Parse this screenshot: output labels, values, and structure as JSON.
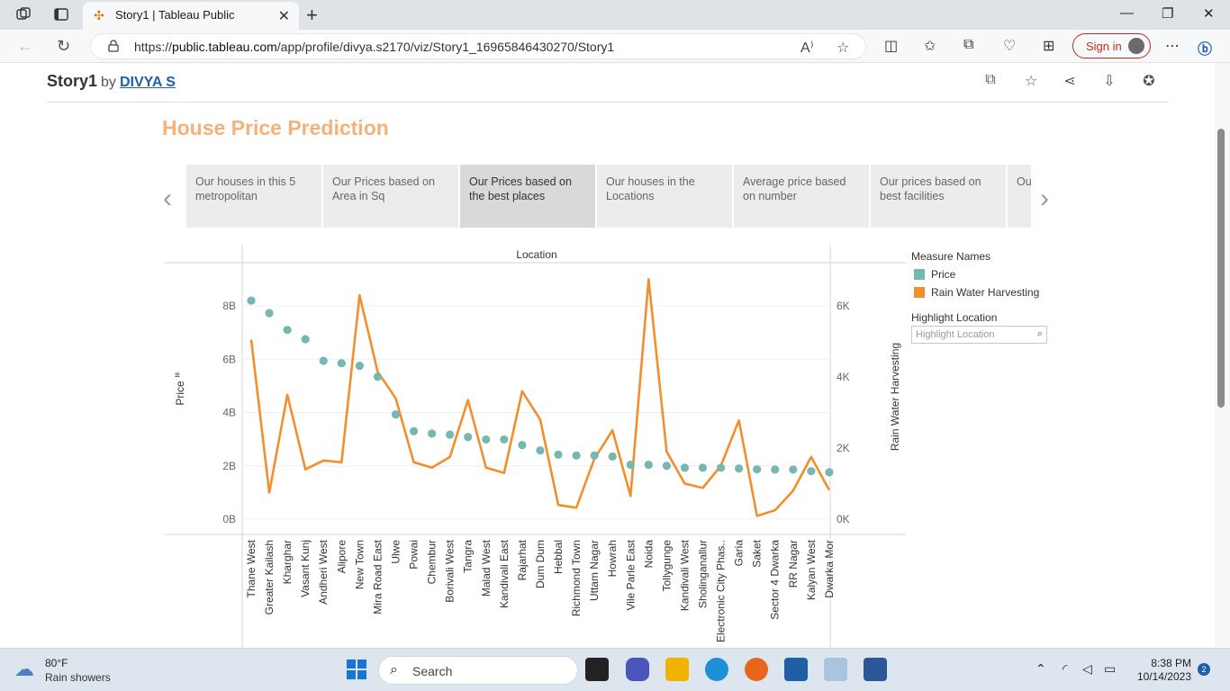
{
  "browser": {
    "tab_title": "Story1 | Tableau Public",
    "url_prefix": "https://",
    "url_host": "public.tableau.com",
    "url_path": "/app/profile/divya.s2170/viz/Story1_16965846430270/Story1",
    "sign_in": "Sign in"
  },
  "story": {
    "name": "Story1",
    "by": "by",
    "author": "DIVYA S",
    "title": "House Price Prediction",
    "points": [
      {
        "label": "Our houses in this 5 metropolitan",
        "active": false
      },
      {
        "label": "Our Prices based on Area in Sq",
        "active": false
      },
      {
        "label": "Our Prices based on the best places",
        "active": true
      },
      {
        "label": "Our houses in the Locations",
        "active": false
      },
      {
        "label": "Average price based on number",
        "active": false
      },
      {
        "label": "Our prices based on best facilities",
        "active": false
      },
      {
        "label": "Ou... bes...",
        "active": false
      }
    ]
  },
  "legend": {
    "title": "Measure Names",
    "items": [
      {
        "label": "Price",
        "color": "#76b7b2"
      },
      {
        "label": "Rain Water Harvesting",
        "color": "#f28e2b"
      }
    ],
    "highlight_title": "Highlight Location",
    "highlight_placeholder": "Highlight Location"
  },
  "chart_data": {
    "type": "line",
    "title": "Location",
    "ylabel": "Price",
    "y2label": "Rain Water Harvesting",
    "ylim": [
      0,
      8900000000
    ],
    "y2lim": [
      0,
      7000
    ],
    "yticks": [
      "0B",
      "2B",
      "4B",
      "6B",
      "8B"
    ],
    "y2ticks": [
      "0K",
      "2K",
      "4K",
      "6K"
    ],
    "categories": [
      "Thane West",
      "Greater Kailash",
      "Kharghar",
      "Vasant Kunj",
      "Andheri West",
      "Alipore",
      "New Town",
      "Mira Road East",
      "Ulwe",
      "Powai",
      "Chembur",
      "Borivali West",
      "Tangra",
      "Malad West",
      "Kandivali East",
      "Rajarhat",
      "Dum Dum",
      "Hebbal",
      "Richmond Town",
      "Uttam Nagar",
      "Howrah",
      "Vile Parle East",
      "Noida",
      "Tollygunge",
      "Kandivali West",
      "Sholinganallur",
      "Electronic City Phas..",
      "Garia",
      "Saket",
      "Sector 4 Dwarka",
      "RR Nagar",
      "Kalyan West",
      "Dwarka Mor"
    ],
    "series": [
      {
        "name": "Price",
        "type": "scatter",
        "color": "#76b7b2",
        "values": [
          8200000000,
          7730000000,
          7100000000,
          6750000000,
          5940000000,
          5850000000,
          5750000000,
          5340000000,
          3930000000,
          3300000000,
          3210000000,
          3170000000,
          3080000000,
          2990000000,
          2990000000,
          2780000000,
          2580000000,
          2420000000,
          2390000000,
          2390000000,
          2350000000,
          2040000000,
          2040000000,
          2000000000,
          1930000000,
          1930000000,
          1930000000,
          1900000000,
          1870000000,
          1860000000,
          1860000000,
          1800000000,
          1760000000
        ]
      },
      {
        "name": "Rain Water Harvesting",
        "type": "line",
        "color": "#f28e2b",
        "values": [
          5050,
          750,
          3500,
          1400,
          1650,
          1600,
          6300,
          4150,
          3400,
          1600,
          1450,
          1750,
          3350,
          1450,
          1300,
          3600,
          2800,
          400,
          320,
          1700,
          2500,
          650,
          6750,
          1900,
          1000,
          880,
          1500,
          2780,
          90,
          250,
          800,
          1750,
          820
        ]
      }
    ]
  },
  "taskbar": {
    "temp": "80°F",
    "condition": "Rain showers",
    "search": "Search",
    "time": "8:38 PM",
    "date": "10/14/2023",
    "notif": "2"
  }
}
